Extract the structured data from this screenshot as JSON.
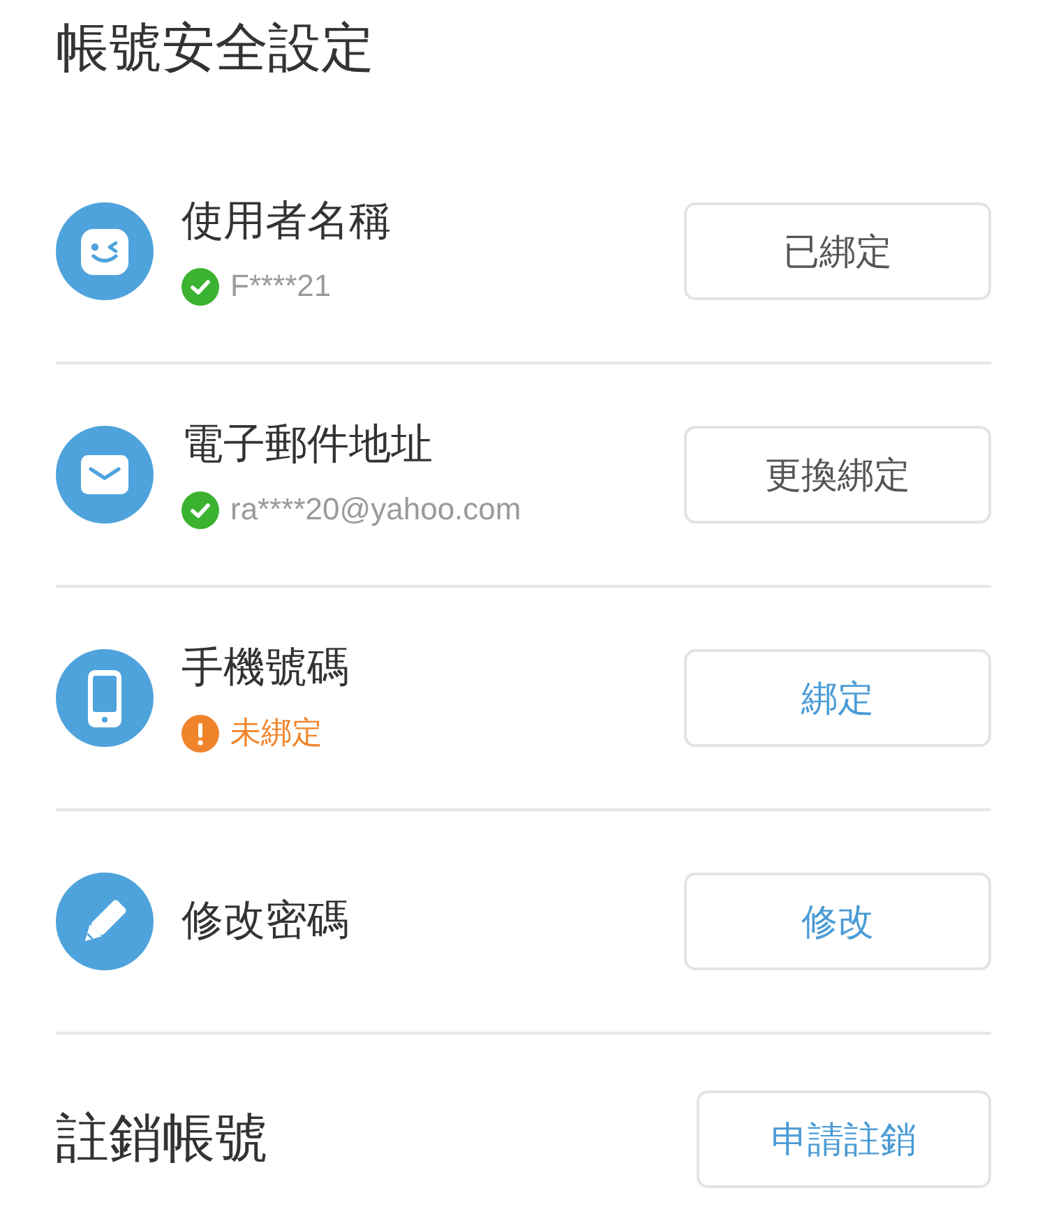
{
  "title": "帳號安全設定",
  "items": [
    {
      "label": "使用者名稱",
      "status": {
        "kind": "verified",
        "text": "F****21"
      },
      "button": {
        "label": "已綁定",
        "kind": "neutral"
      }
    },
    {
      "label": "電子郵件地址",
      "status": {
        "kind": "verified",
        "text": "ra****20@yahoo.com"
      },
      "button": {
        "label": "更換綁定",
        "kind": "neutral"
      }
    },
    {
      "label": "手機號碼",
      "status": {
        "kind": "warning",
        "text": "未綁定"
      },
      "button": {
        "label": "綁定",
        "kind": "accent"
      }
    },
    {
      "label": "修改密碼",
      "button": {
        "label": "修改",
        "kind": "accent"
      }
    }
  ],
  "deactivate": {
    "title": "註銷帳號",
    "button": {
      "label": "申請註銷",
      "kind": "accent"
    }
  }
}
